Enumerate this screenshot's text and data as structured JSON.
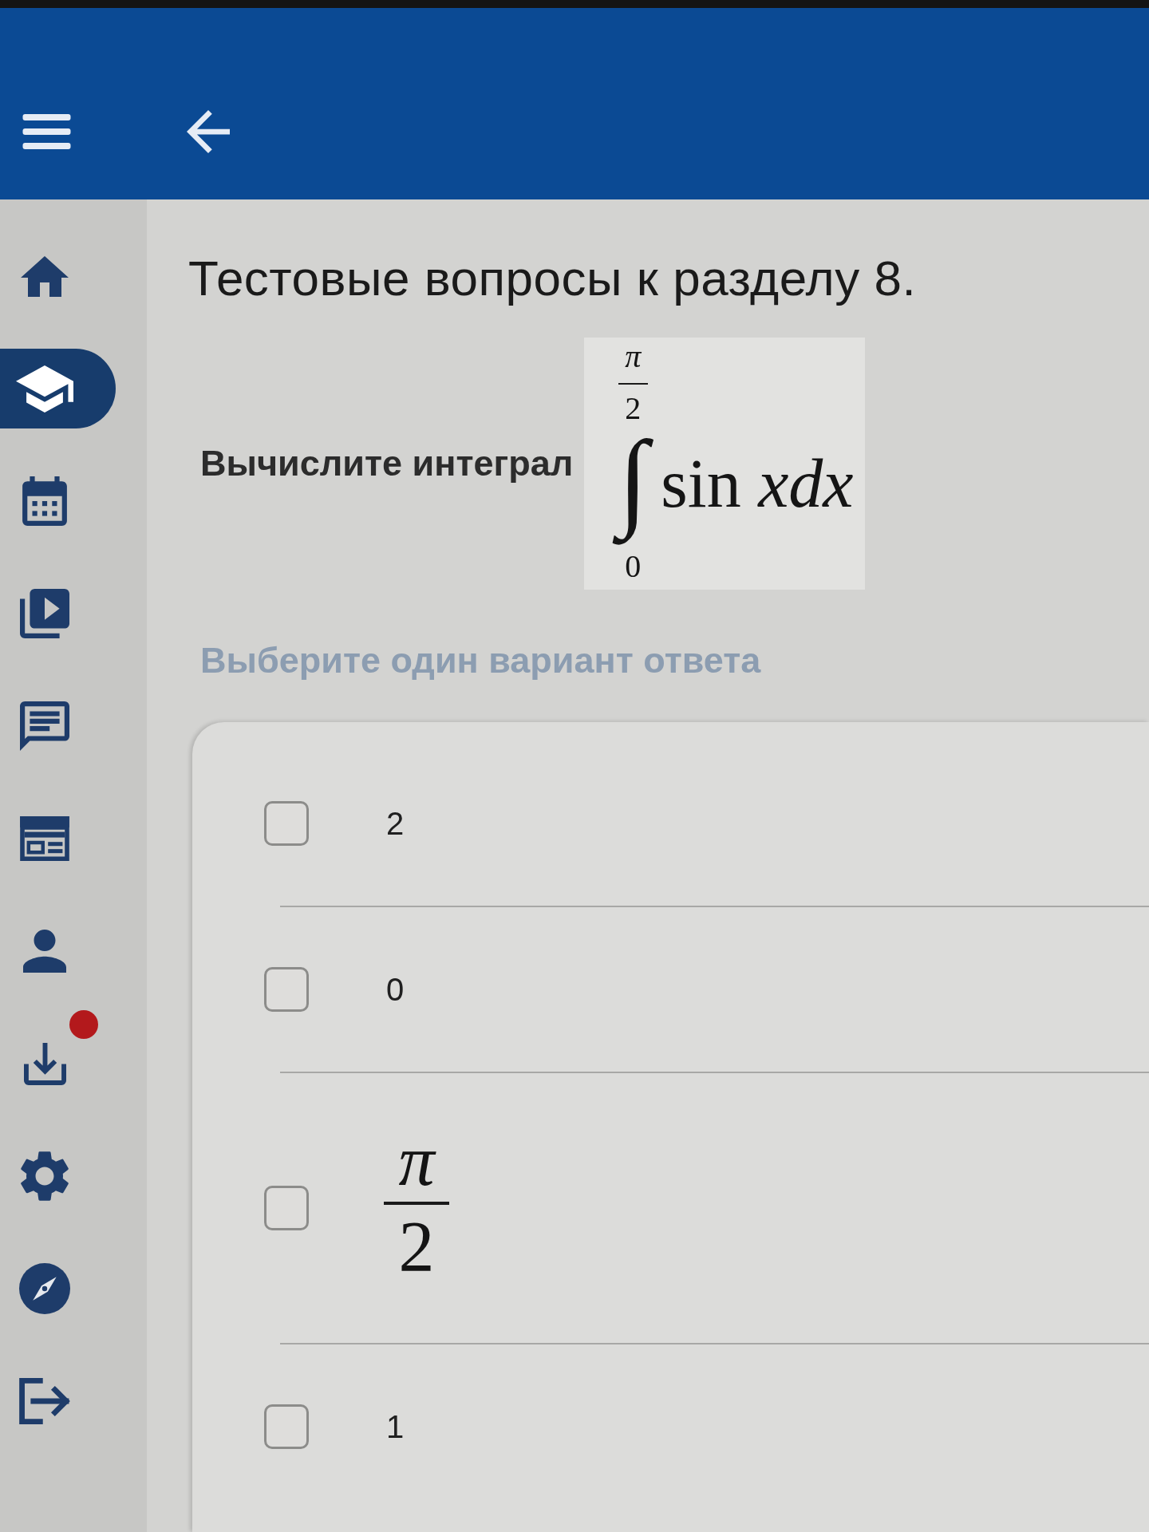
{
  "sidebar": {
    "items": [
      {
        "selected": false,
        "notification": false
      },
      {
        "selected": true,
        "notification": false
      },
      {
        "selected": false,
        "notification": false
      },
      {
        "selected": false,
        "notification": false
      },
      {
        "selected": false,
        "notification": false
      },
      {
        "selected": false,
        "notification": false
      },
      {
        "selected": false,
        "notification": false
      },
      {
        "selected": false,
        "notification": true
      },
      {
        "selected": false,
        "notification": false
      },
      {
        "selected": false,
        "notification": false
      },
      {
        "selected": false,
        "notification": false
      }
    ]
  },
  "page": {
    "title": "Тестовые вопросы к разделу 8."
  },
  "question": {
    "text": "Вычислите интеграл",
    "formula": {
      "upper_limit": {
        "numerator": "π",
        "denominator": "2"
      },
      "sign": "∫",
      "lower_limit": "0",
      "integrand": "sin *xdx*"
    },
    "instruction": "Выберите один вариант ответа"
  },
  "answers": {
    "options": [
      {
        "kind": "text",
        "label": "2",
        "selected": false
      },
      {
        "kind": "text",
        "label": "0",
        "selected": false
      },
      {
        "kind": "fraction",
        "numerator": "π",
        "denominator": "2",
        "selected": false
      },
      {
        "kind": "text",
        "label": "1",
        "selected": false
      }
    ]
  }
}
